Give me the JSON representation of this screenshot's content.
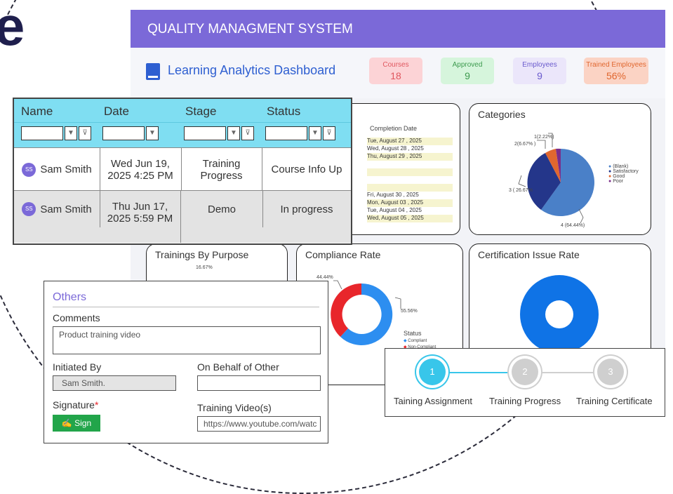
{
  "header": {
    "title": "QUALITY MANAGMENT SYSTEM"
  },
  "dashboard": {
    "title": "Learning Analytics Dashboard",
    "kpis": [
      {
        "label": "Courses",
        "value": "18",
        "bg": "#fcd3d6",
        "fg": "#e0575f"
      },
      {
        "label": "Approved",
        "value": "9",
        "bg": "#d6f5dc",
        "fg": "#3c9a4e"
      },
      {
        "label": "Employees",
        "value": "9",
        "bg": "#ebe6fa",
        "fg": "#6a5acd"
      },
      {
        "label": "Trained Employees",
        "value": "56%",
        "bg": "#fbd3c4",
        "fg": "#e0672f"
      }
    ]
  },
  "completion": {
    "header": "Completion Date",
    "dates": [
      "Tue, August 27 , 2025",
      "Wed, August 28 , 2025",
      "Thu, August 29 , 2025",
      "Fri, August 30 , 2025",
      "Mon, August 03 , 2025",
      "Tue, August 04 , 2025",
      "Wed, August 05 , 2025"
    ]
  },
  "categories_chart": {
    "title": "Categories",
    "labels": [
      "1(2.22%)",
      "2(6.67% )",
      "3 ( 26.67%",
      "4 (64.44%)"
    ],
    "legend": [
      "(Blank)",
      "Satisfactory",
      "Good",
      "Poor"
    ]
  },
  "purpose_chart": {
    "title": "Trainings By Purpose",
    "label": "16.67%"
  },
  "compliance_chart": {
    "title": "Compliance Rate",
    "labels": [
      "44.44%",
      "55.56%"
    ],
    "legend_title": "Status",
    "legend": [
      "Compliant",
      "Non-Compliant"
    ]
  },
  "cert_chart": {
    "title": "Certification Issue Rate"
  },
  "list": {
    "columns": [
      "Name",
      "Date",
      "Stage",
      "Status"
    ],
    "rows": [
      {
        "initials": "SS",
        "name": "Sam Smith",
        "date": "Wed Jun 19, 2025 4:25 PM",
        "stage": "Training Progress",
        "status": "Course Info Up"
      },
      {
        "initials": "SS",
        "name": "Sam Smith",
        "date": "Thu Jun 17, 2025 5:59 PM",
        "stage": "Demo",
        "status": "In progress"
      }
    ]
  },
  "form": {
    "section": "Others",
    "comments_label": "Comments",
    "comments_value": "Product training video",
    "initiated_label": "Initiated By",
    "initiated_value": "Sam Smith.",
    "behalf_label": "On Behalf of Other",
    "signature_label": "Signature",
    "required_mark": "*",
    "sign_button": "Sign",
    "video_label": "Training Video(s)",
    "video_value": "https://www.youtube.com/watc"
  },
  "stepper": {
    "steps": [
      {
        "num": "1",
        "label": "Taining Assignment"
      },
      {
        "num": "2",
        "label": "Training Progress"
      },
      {
        "num": "3",
        "label": "Training Certificate"
      }
    ]
  },
  "colors": {
    "accent": "#7b69d8",
    "cyan": "#7fdef2",
    "blue": "#1e7be6",
    "red": "#e8262b"
  }
}
